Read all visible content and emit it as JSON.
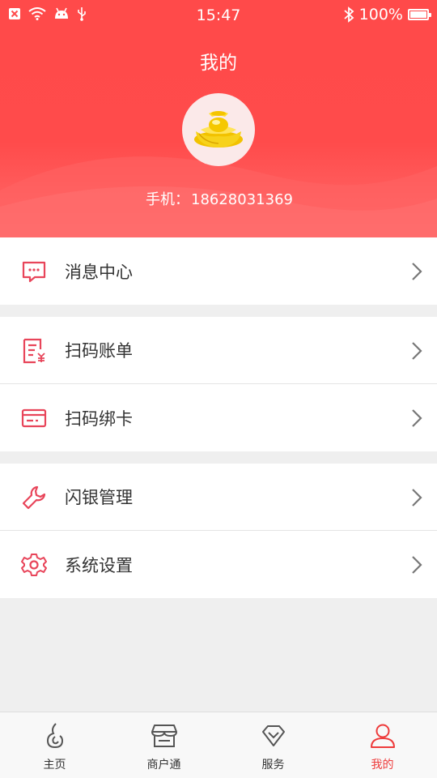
{
  "status": {
    "time": "15:47",
    "battery": "100%"
  },
  "header": {
    "title": "我的",
    "phone_label": "手机：",
    "phone_number": "18628031369"
  },
  "menu": {
    "group1": [
      {
        "label": "消息中心",
        "icon": "message-icon"
      }
    ],
    "group2": [
      {
        "label": "扫码账单",
        "icon": "bill-icon"
      },
      {
        "label": "扫码绑卡",
        "icon": "card-icon"
      }
    ],
    "group3": [
      {
        "label": "闪银管理",
        "icon": "wrench-icon"
      },
      {
        "label": "系统设置",
        "icon": "settings-icon"
      }
    ]
  },
  "tabs": [
    {
      "label": "主页",
      "icon": "home-icon",
      "active": false
    },
    {
      "label": "商户通",
      "icon": "store-icon",
      "active": false
    },
    {
      "label": "服务",
      "icon": "diamond-icon",
      "active": false
    },
    {
      "label": "我的",
      "icon": "user-icon",
      "active": true
    }
  ],
  "colors": {
    "header_red": "#ff4b4b",
    "accent": "#ee3b3b",
    "icon_red": "#e8455a"
  }
}
